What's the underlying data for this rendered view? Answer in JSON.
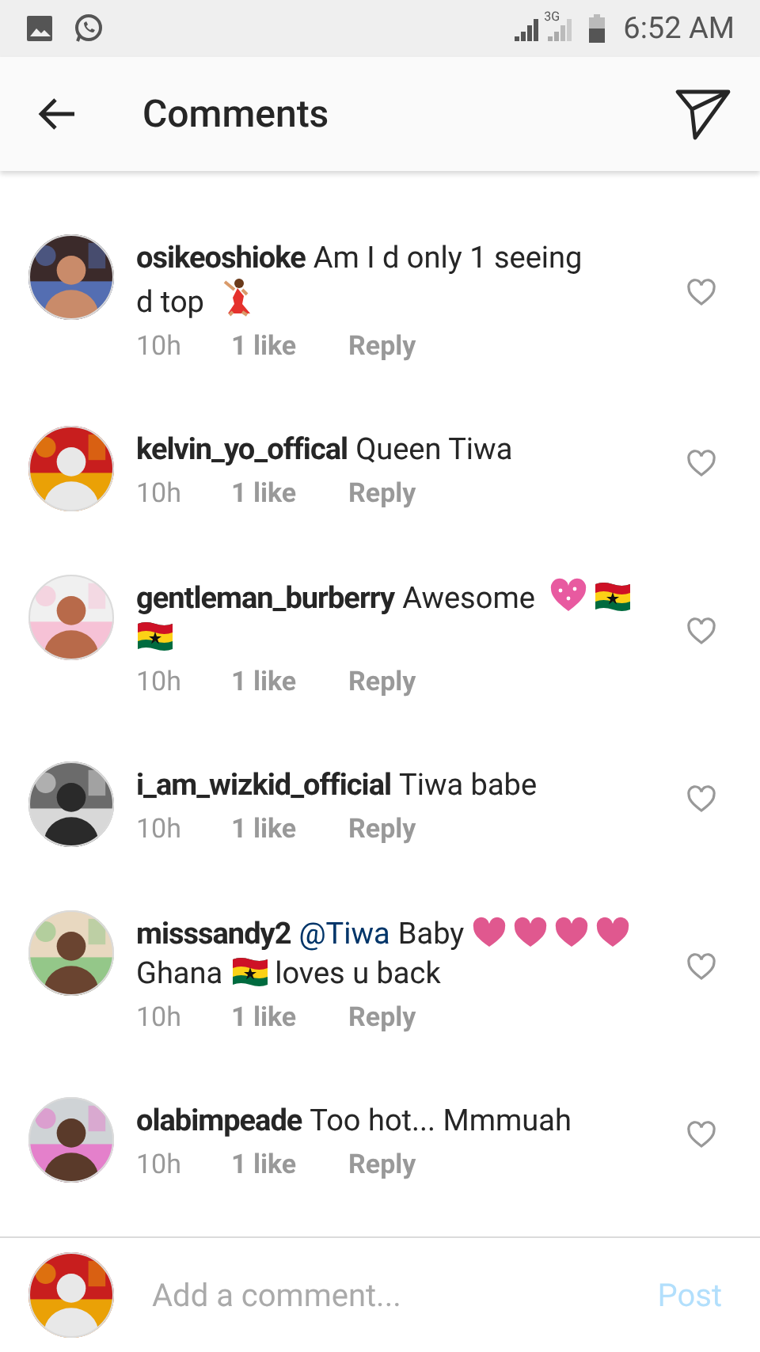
{
  "status_bar": {
    "network": "3G",
    "time": "6:52 AM"
  },
  "header": {
    "title": "Comments"
  },
  "comments": [
    {
      "avatar": {
        "kind": "picture"
      },
      "username": "osikeoshioke",
      "parts": [
        {
          "kind": "text",
          "text": "Am I d only 1 seeing"
        },
        {
          "kind": "text",
          "text": "d top"
        },
        {
          "kind": "dancer"
        }
      ],
      "time": "10h",
      "likes": "1 like",
      "reply": "Reply",
      "liked": false
    },
    {
      "avatar": {
        "kind": "picture"
      },
      "username": "kelvin_yo_offical",
      "parts": [
        {
          "kind": "text",
          "text": "Queen Tiwa"
        }
      ],
      "time": "10h",
      "likes": "1 like",
      "reply": "Reply",
      "liked": false
    },
    {
      "avatar": {
        "kind": "picture"
      },
      "username": "gentleman_burberry",
      "parts": [
        {
          "kind": "text",
          "text": "Awesome"
        },
        {
          "kind": "sparkle_heart"
        },
        {
          "kind": "flag"
        },
        {
          "kind": "flag"
        }
      ],
      "time": "10h",
      "likes": "1 like",
      "reply": "Reply",
      "liked": false
    },
    {
      "avatar": {
        "kind": "picture"
      },
      "username": "i_am_wizkid_official",
      "parts": [
        {
          "kind": "text",
          "text": "Tiwa babe"
        }
      ],
      "time": "10h",
      "likes": "1 like",
      "reply": "Reply",
      "liked": false
    },
    {
      "avatar": {
        "kind": "picture"
      },
      "username": "misssandy2",
      "parts": [
        {
          "kind": "mention",
          "text": "@Tiwa"
        },
        {
          "kind": "text",
          "text": "Baby"
        },
        {
          "kind": "heart"
        },
        {
          "kind": "heart"
        },
        {
          "kind": "heart"
        },
        {
          "kind": "heart"
        },
        {
          "kind": "text",
          "text": "Ghana"
        },
        {
          "kind": "flag"
        },
        {
          "kind": "text",
          "text": "loves u back"
        }
      ],
      "time": "10h",
      "likes": "1 like",
      "reply": "Reply",
      "liked": false
    },
    {
      "avatar": {
        "kind": "picture"
      },
      "username": "olabimpeade",
      "parts": [
        {
          "kind": "text",
          "text": "Too hot... Mmmuah"
        }
      ],
      "time": "10h",
      "likes": "1 like",
      "reply": "Reply",
      "liked": false
    }
  ],
  "composer": {
    "avatar": {
      "kind": "picture"
    },
    "placeholder": "Add a comment...",
    "post": "Post",
    "post_enabled": false
  }
}
